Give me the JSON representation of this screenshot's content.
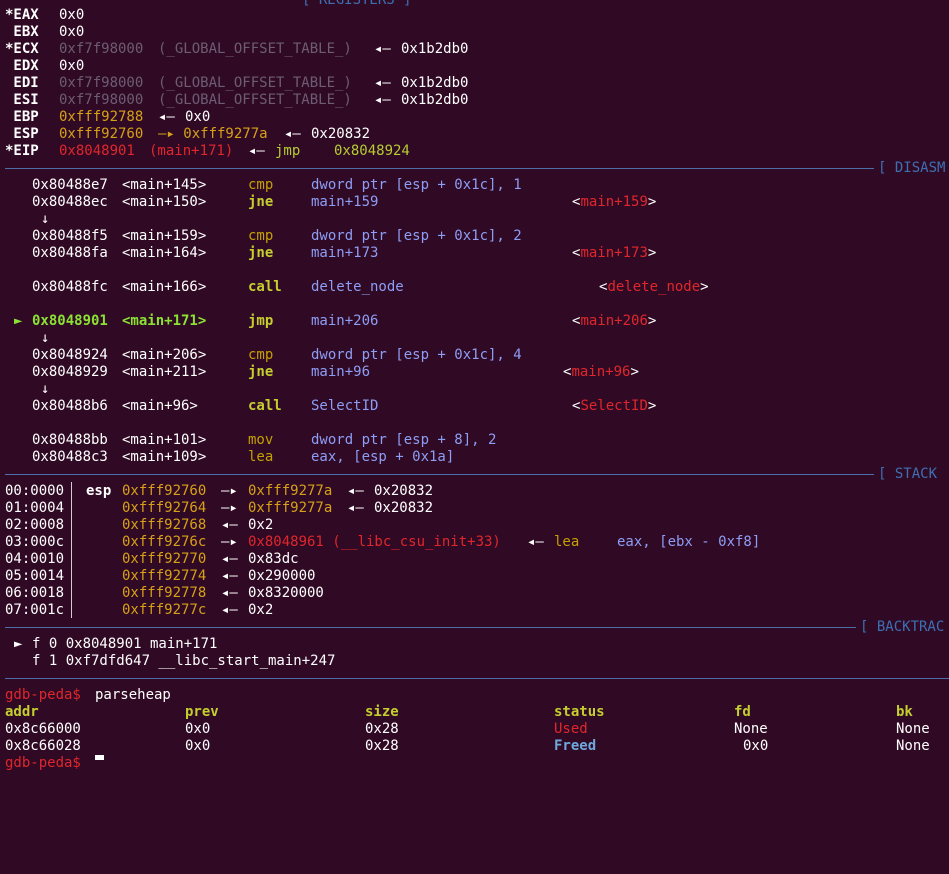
{
  "colors": {
    "background": "#300a24",
    "separator": "#4e6ea8",
    "address_yellow": "#d6a118",
    "code_red": "#e0262c",
    "current_green": "#8ae234",
    "opcode_yellow": "#c4cf2f",
    "operand_blue": "#8e9df5"
  },
  "sections": {
    "registers": "[ REGISTERS ]",
    "disasm": "[ DISASM",
    "stack": "[ STACK",
    "backtrace": "[ BACKTRAC"
  },
  "registers": [
    {
      "name": "*EAX",
      "value": "0x0",
      "note": "",
      "arrow": "",
      "target": ""
    },
    {
      "name": " EBX",
      "value": "0x0",
      "note": "",
      "arrow": "",
      "target": ""
    },
    {
      "name": "*ECX",
      "value": "0xf7f98000",
      "note": "(_GLOBAL_OFFSET_TABLE_)",
      "arrow": "◂—",
      "target": "0x1b2db0"
    },
    {
      "name": " EDX",
      "value": "0x0",
      "note": "",
      "arrow": "",
      "target": ""
    },
    {
      "name": " EDI",
      "value": "0xf7f98000",
      "note": "(_GLOBAL_OFFSET_TABLE_)",
      "arrow": "◂—",
      "target": "0x1b2db0"
    },
    {
      "name": " ESI",
      "value": "0xf7f98000",
      "note": "(_GLOBAL_OFFSET_TABLE_)",
      "arrow": "◂—",
      "target": "0x1b2db0"
    },
    {
      "name": " EBP",
      "value": "0xfff92788",
      "note": "",
      "arrow": "◂—",
      "target": "0x0"
    },
    {
      "name": " ESP",
      "value": "0xfff92760",
      "note": "—▸ 0xfff9277a",
      "arrow": "◂—",
      "target": "0x20832"
    },
    {
      "name": "*EIP",
      "value": "0x8048901",
      "note": "(main+171)",
      "arrow": "◂—",
      "target": "jmp    0x8048924"
    }
  ],
  "disasm": [
    {
      "marker": "",
      "addr": "0x80488e7",
      "sym": "<main+145>",
      "op": "cmp",
      "args": "dword ptr [esp + 0x1c], 1",
      "ref": ""
    },
    {
      "marker": "",
      "addr": "0x80488ec",
      "sym": "<main+150>",
      "op": "jne",
      "args": "main+159",
      "ref": "main+159"
    },
    {
      "marker": "",
      "addr": "0x80488f5",
      "sym": "<main+159>",
      "op": "cmp",
      "args": "dword ptr [esp + 0x1c], 2",
      "ref": ""
    },
    {
      "marker": "",
      "addr": "0x80488fa",
      "sym": "<main+164>",
      "op": "jne",
      "args": "main+173",
      "ref": "main+173"
    },
    {
      "marker": "",
      "addr": "0x80488fc",
      "sym": "<main+166>",
      "op": "call",
      "args": "delete_node",
      "ref": "delete_node"
    },
    {
      "marker": "►",
      "addr": "0x8048901",
      "sym": "<main+171>",
      "op": "jmp",
      "args": "main+206",
      "ref": "main+206"
    },
    {
      "marker": "",
      "addr": "0x8048924",
      "sym": "<main+206>",
      "op": "cmp",
      "args": "dword ptr [esp + 0x1c], 4",
      "ref": ""
    },
    {
      "marker": "",
      "addr": "0x8048929",
      "sym": "<main+211>",
      "op": "jne",
      "args": "main+96",
      "ref": "main+96"
    },
    {
      "marker": "",
      "addr": "0x80488b6",
      "sym": "<main+96>",
      "op": "call",
      "args": "SelectID",
      "ref": "SelectID"
    },
    {
      "marker": "",
      "addr": "0x80488bb",
      "sym": "<main+101>",
      "op": "mov",
      "args": "dword ptr [esp + 8], 2",
      "ref": ""
    },
    {
      "marker": "",
      "addr": "0x80488c3",
      "sym": "<main+109>",
      "op": "lea",
      "args": "eax, [esp + 0x1a]",
      "ref": ""
    }
  ],
  "down_arrow": "↓",
  "stack": [
    {
      "idx": "00:0000",
      "reg": "esp",
      "addr": "0xfff92760",
      "a1": "—▸",
      "ptr": "0xfff9277a",
      "a2": "◂—",
      "val": "0x20832",
      "extra": ""
    },
    {
      "idx": "01:0004",
      "reg": "",
      "addr": "0xfff92764",
      "a1": "—▸",
      "ptr": "0xfff9277a",
      "a2": "◂—",
      "val": "0x20832",
      "extra": ""
    },
    {
      "idx": "02:0008",
      "reg": "",
      "addr": "0xfff92768",
      "a1": "",
      "ptr": "",
      "a2": "◂—",
      "val": "0x2",
      "extra": ""
    },
    {
      "idx": "03:000c",
      "reg": "",
      "addr": "0xfff9276c",
      "a1": "—▸",
      "ptr": "0x8048961 (__libc_csu_init+33)",
      "a2": "◂—",
      "val": "lea",
      "extra": "eax, [ebx - 0xf8]"
    },
    {
      "idx": "04:0010",
      "reg": "",
      "addr": "0xfff92770",
      "a1": "",
      "ptr": "",
      "a2": "◂—",
      "val": "0x83dc",
      "extra": ""
    },
    {
      "idx": "05:0014",
      "reg": "",
      "addr": "0xfff92774",
      "a1": "",
      "ptr": "",
      "a2": "◂—",
      "val": "0x290000",
      "extra": ""
    },
    {
      "idx": "06:0018",
      "reg": "",
      "addr": "0xfff92778",
      "a1": "",
      "ptr": "",
      "a2": "◂—",
      "val": "0x8320000",
      "extra": ""
    },
    {
      "idx": "07:001c",
      "reg": "",
      "addr": "0xfff9277c",
      "a1": "",
      "ptr": "",
      "a2": "◂—",
      "val": "0x2",
      "extra": ""
    }
  ],
  "backtrace": [
    {
      "marker": "►",
      "text": "f 0 0x8048901 main+171"
    },
    {
      "marker": "",
      "text": "f 1 0xf7dfd647 __libc_start_main+247"
    }
  ],
  "prompt": {
    "label": "gdb-peda$",
    "command": "parseheap",
    "next_label": "gdb-peda$"
  },
  "heap": {
    "headers": [
      "addr",
      "prev",
      "size",
      "status",
      "fd",
      "bk"
    ],
    "rows": [
      {
        "addr": "0x8c66000",
        "prev": "0x0",
        "size": "0x28",
        "status": "Used",
        "fd": "None",
        "bk": "None"
      },
      {
        "addr": "0x8c66028",
        "prev": "0x0",
        "size": "0x28",
        "status": "Freed",
        "fd": "0x0",
        "bk": "None"
      }
    ]
  }
}
